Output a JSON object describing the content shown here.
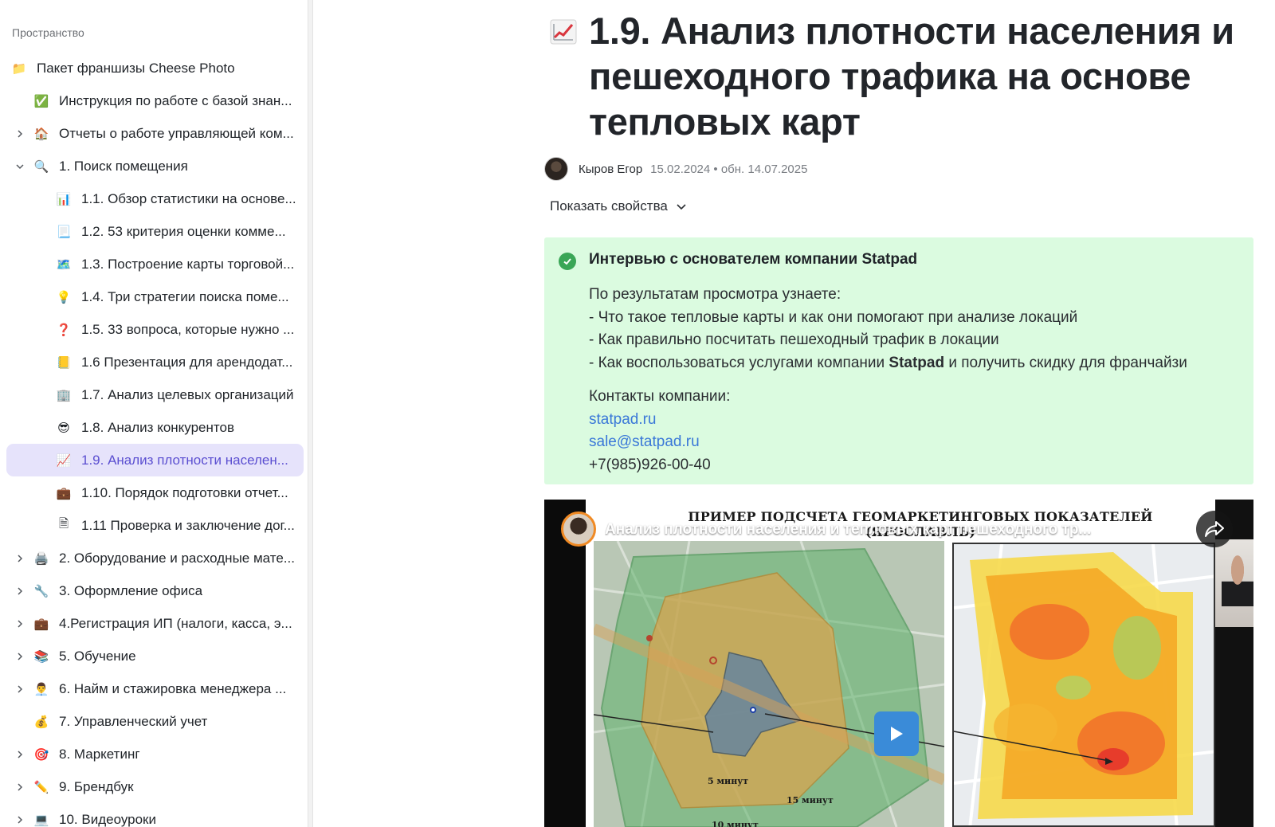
{
  "sidebar": {
    "space_label": "Пространство",
    "items": [
      {
        "label": "Пакет франшизы Cheese Photo",
        "icon": "folder-icon",
        "glyph": "📁",
        "level": 0,
        "chevron": ""
      },
      {
        "label": "Инструкция по работе с базой знан...",
        "icon": "check-mark-icon",
        "glyph": "✅",
        "level": 1,
        "chevron": ""
      },
      {
        "label": "Отчеты о работе управляющей ком...",
        "icon": "house-icon",
        "glyph": "🏠",
        "level": 1,
        "chevron": "right"
      },
      {
        "label": "1. Поиск помещения",
        "icon": "magnifier-icon",
        "glyph": "🔍",
        "level": 1,
        "chevron": "down"
      },
      {
        "label": "1.1. Обзор статистики на основе...",
        "icon": "bar-chart-icon",
        "glyph": "📊",
        "level": 2,
        "chevron": ""
      },
      {
        "label": "1.2. 53 критерия оценки комме...",
        "icon": "scroll-icon",
        "glyph": "📃",
        "level": 2,
        "chevron": ""
      },
      {
        "label": "1.3. Построение карты торговой...",
        "icon": "map-icon",
        "glyph": "🗺️",
        "level": 2,
        "chevron": ""
      },
      {
        "label": "1.4. Три стратегии поиска поме...",
        "icon": "light-bulb-icon",
        "glyph": "💡",
        "level": 2,
        "chevron": ""
      },
      {
        "label": "1.5. 33 вопроса, которые нужно ...",
        "icon": "question-mark-icon",
        "glyph": "❓",
        "level": 2,
        "chevron": ""
      },
      {
        "label": "1.6 Презентация для арендодат...",
        "icon": "ledger-icon",
        "glyph": "📒",
        "level": 2,
        "chevron": ""
      },
      {
        "label": "1.7. Анализ целевых организаций",
        "icon": "office-building-icon",
        "glyph": "🏢",
        "level": 2,
        "chevron": ""
      },
      {
        "label": "1.8. Анализ конкурентов",
        "icon": "sunglasses-face-icon",
        "glyph": "😎",
        "level": 2,
        "chevron": ""
      },
      {
        "label": "1.9. Анализ плотности населен...",
        "icon": "chart-increasing-icon",
        "glyph": "📈",
        "level": 2,
        "chevron": "",
        "active": true
      },
      {
        "label": "1.10. Порядок подготовки отчет...",
        "icon": "briefcase-icon",
        "glyph": "💼",
        "level": 2,
        "chevron": ""
      },
      {
        "label": "1.11 Проверка и заключение дог...",
        "icon": "document-icon",
        "glyph": "🗎",
        "level": 2,
        "chevron": ""
      },
      {
        "label": "2. Оборудование и расходные мате...",
        "icon": "printer-icon",
        "glyph": "🖨️",
        "level": 1,
        "chevron": "right"
      },
      {
        "label": "3. Оформление офиса",
        "icon": "wrench-icon",
        "glyph": "🔧",
        "level": 1,
        "chevron": "right"
      },
      {
        "label": "4.Регистрация ИП (налоги, касса, э...",
        "icon": "briefcase-icon",
        "glyph": "💼",
        "level": 1,
        "chevron": "right"
      },
      {
        "label": "5. Обучение",
        "icon": "books-icon",
        "glyph": "📚",
        "level": 1,
        "chevron": "right"
      },
      {
        "label": "6. Найм и стажировка менеджера ...",
        "icon": "man-icon",
        "glyph": "👨‍💼",
        "level": 1,
        "chevron": "right"
      },
      {
        "label": "7. Управленческий учет",
        "icon": "money-bag-icon",
        "glyph": "💰",
        "level": 1,
        "chevron": ""
      },
      {
        "label": "8. Маркетинг",
        "icon": "target-icon",
        "glyph": "🎯",
        "level": 1,
        "chevron": "right"
      },
      {
        "label": "9. Брендбук",
        "icon": "pencil-icon",
        "glyph": "✏️",
        "level": 1,
        "chevron": "right"
      },
      {
        "label": "10. Видеоуроки",
        "icon": "computer-icon",
        "glyph": "💻",
        "level": 1,
        "chevron": "right"
      }
    ]
  },
  "page": {
    "title_icon": "chart-increasing-icon",
    "title": "1.9. Анализ плотности населения и пешеходного трафика на основе тепловых карт",
    "author": "Кыров Егор",
    "dates": "15.02.2024 • обн. 14.07.2025",
    "show_properties": "Показать свойства"
  },
  "callout": {
    "heading": "Интервью с основателем компании Statpad",
    "intro": "По результатам просмотра узнаете:",
    "bullet1": "- Что такое тепловые карты и как они помогают при анализе локаций",
    "bullet2": "- Как правильно посчитать пешеходный трафик в локации",
    "bullet3_pre": "- Как воспользоваться услугами компании ",
    "bullet3_bold": "Statpad",
    "bullet3_post": " и получить скидку для франчайзи",
    "contacts_label": "Контакты компании:",
    "site": "statpad.ru",
    "email": "sale@statpad.ru",
    "phone": "+7(985)926-00-40"
  },
  "video": {
    "slide_title": "ПРИМЕР ПОДСЧЕТА ГЕОМАРКЕТИНГОВЫХ ПОКАЗАТЕЛЕЙ (ЯРОСЛАВЛЬ)",
    "video_title": "Анализ плотности населения и тепловых карт пешеходного тр...",
    "label_5min": "5 минут",
    "label_10min": "10 минут",
    "label_15min": "15 минут"
  },
  "colors": {
    "accent": "#5b4fd1",
    "active_bg": "#e6e3fb",
    "callout_bg": "#dbfbe0",
    "check_green": "#3aa657",
    "link": "#3a78d8",
    "play_button": "#3a8bd8"
  }
}
